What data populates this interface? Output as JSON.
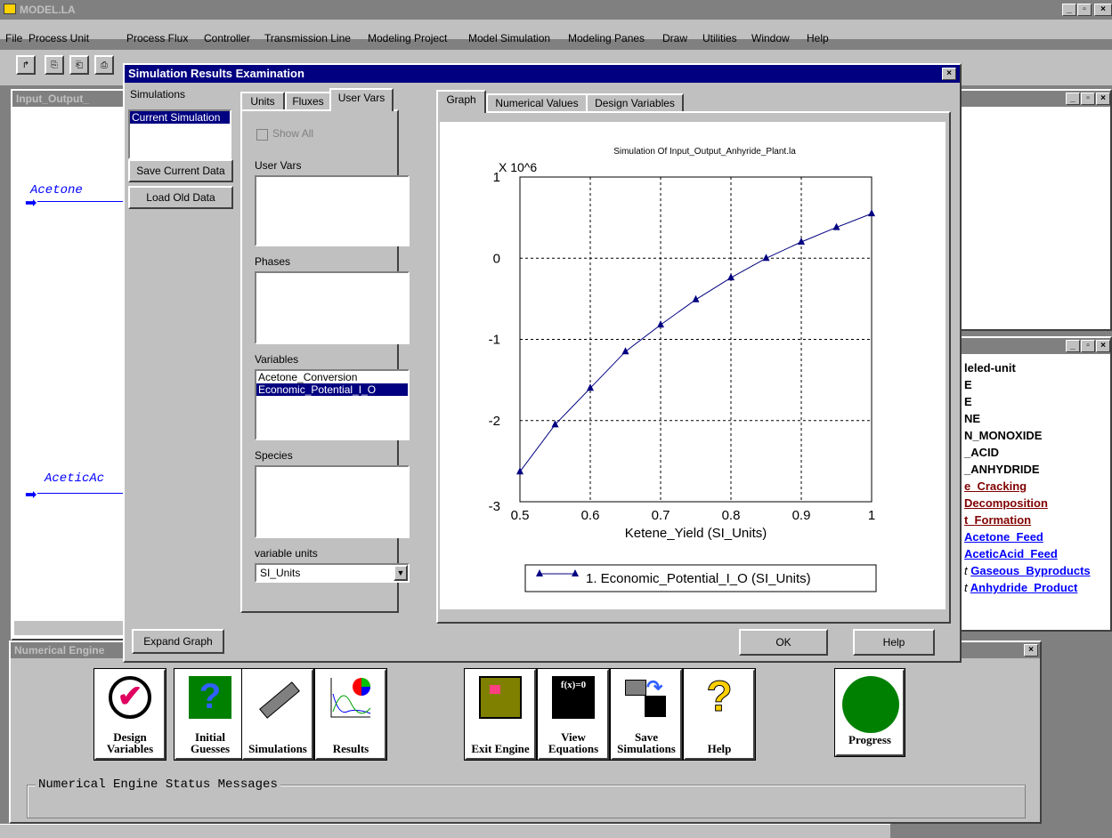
{
  "app": {
    "title": "MODEL.LA"
  },
  "menu": [
    "File",
    "Process Unit",
    "Process Flux",
    "Controller",
    "Transmission Line",
    "Modeling Project",
    "Model Simulation",
    "Modeling Panes",
    "Draw",
    "Utilities",
    "Window",
    "Help"
  ],
  "background_window": {
    "title": "Input_Output_",
    "streams": [
      "Acetone",
      "AceticAc"
    ]
  },
  "right_panel": {
    "items": [
      {
        "text": "leled-unit",
        "style": "plain"
      },
      {
        "text": "E",
        "style": "plain"
      },
      {
        "text": "E",
        "style": "plain"
      },
      {
        "text": "NE",
        "style": "plain"
      },
      {
        "text": "N_MONOXIDE",
        "style": "plain"
      },
      {
        "text": "_ACID",
        "style": "plain"
      },
      {
        "text": "_ANHYDRIDE",
        "style": "plain"
      },
      {
        "text": "e_Cracking",
        "style": "red"
      },
      {
        "text": "Decomposition",
        "style": "red"
      },
      {
        "text": "t_Formation",
        "style": "red"
      },
      {
        "text": "Acetone_Feed",
        "style": "blue"
      },
      {
        "text": "AceticAcid_Feed",
        "style": "blue"
      },
      {
        "text": "Gaseous_Byproducts",
        "style": "blue",
        "prefix": "t"
      },
      {
        "text": "Anhydride_Product",
        "style": "blue",
        "prefix": "t"
      }
    ]
  },
  "dialog": {
    "title": "Simulation Results Examination",
    "simulations_label": "Simulations",
    "simulations": [
      "Current Simulation"
    ],
    "save_current_data": "Save Current Data",
    "load_old_data": "Load Old Data",
    "left_tabs": [
      "Units",
      "Fluxes",
      "User Vars"
    ],
    "show_all": "Show All",
    "user_vars_label": "User Vars",
    "phases_label": "Phases",
    "variables_label": "Variables",
    "variables": [
      "Acetone_Conversion",
      "Economic_Potential_I_O"
    ],
    "species_label": "Species",
    "variable_units_label": "variable units",
    "variable_units_value": "SI_Units",
    "right_tabs": [
      "Graph",
      "Numerical Values",
      "Design Variables"
    ],
    "expand_graph": "Expand Graph",
    "ok": "OK",
    "help": "Help"
  },
  "chart_data": {
    "type": "line",
    "title": "Simulation Of Input_Output_Anhyride_Plant.la",
    "multiplier": "X 10^6",
    "xlabel": "Ketene_Yield (SI_Units)",
    "xlim": [
      0.5,
      1
    ],
    "ylim": [
      -3,
      1
    ],
    "xticks": [
      "0.5",
      "0.6",
      "0.7",
      "0.8",
      "0.9",
      "1"
    ],
    "yticks": [
      "1",
      "0",
      "-1",
      "-2",
      "-3"
    ],
    "grid": true,
    "series": [
      {
        "name": "1.  Economic_Potential_I_O (SI_Units)",
        "x": [
          0.5,
          0.55,
          0.6,
          0.65,
          0.7,
          0.75,
          0.8,
          0.85,
          0.9,
          0.95,
          1.0
        ],
        "y": [
          -2.63,
          -2.05,
          -1.6,
          -1.15,
          -0.82,
          -0.51,
          -0.24,
          0.0,
          0.2,
          0.38,
          0.55
        ]
      }
    ]
  },
  "engine": {
    "title": "Numerical Engine",
    "tools": [
      {
        "label": "Design Variables",
        "icon": "checkmark-icon"
      },
      {
        "label": "Initial Guesses",
        "icon": "question-marks-icon"
      },
      {
        "label": "Simulations",
        "icon": "slide-rule-icon"
      },
      {
        "label": "Results",
        "icon": "results-plot-icon"
      },
      {
        "label": "Exit Engine",
        "icon": "exit-door-icon"
      },
      {
        "label": "View Equations",
        "icon": "equations-board-icon"
      },
      {
        "label": "Save Simulations",
        "icon": "save-disk-icon"
      },
      {
        "label": "Help",
        "icon": "help-question-icon"
      },
      {
        "label": "Progress",
        "icon": "progress-light-icon"
      }
    ],
    "status_label": "Numerical Engine Status Messages"
  }
}
